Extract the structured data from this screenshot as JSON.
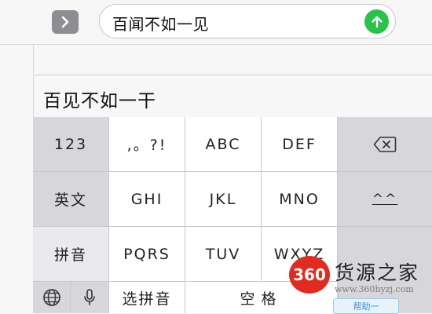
{
  "input_bar": {
    "expand_icon": "chevron-right-icon",
    "message_text": "百闻不如一见",
    "send_icon": "arrow-up-icon",
    "send_color": "#29c24b"
  },
  "candidates": {
    "first": "百见不如一干"
  },
  "keyboard": {
    "row1": {
      "k1": "123",
      "k2": ",。?!",
      "k3": "ABC",
      "k4": "DEF",
      "backspace_icon": "backspace-icon"
    },
    "row2": {
      "k1": "英文",
      "k2": "GHI",
      "k3": "JKL",
      "k4": "MNO",
      "k5": "^^"
    },
    "row3": {
      "k1": "拼音",
      "k2": "PQRS",
      "k3": "TUV",
      "k4": "WXYZ"
    },
    "row4": {
      "globe_icon": "globe-icon",
      "mic_icon": "microphone-icon",
      "k3": "选拼音",
      "k4": "空格"
    }
  },
  "watermark": {
    "logo_text": "360",
    "name": "货源之家",
    "url": "www.360hyzj.com",
    "help": "帮助一"
  }
}
